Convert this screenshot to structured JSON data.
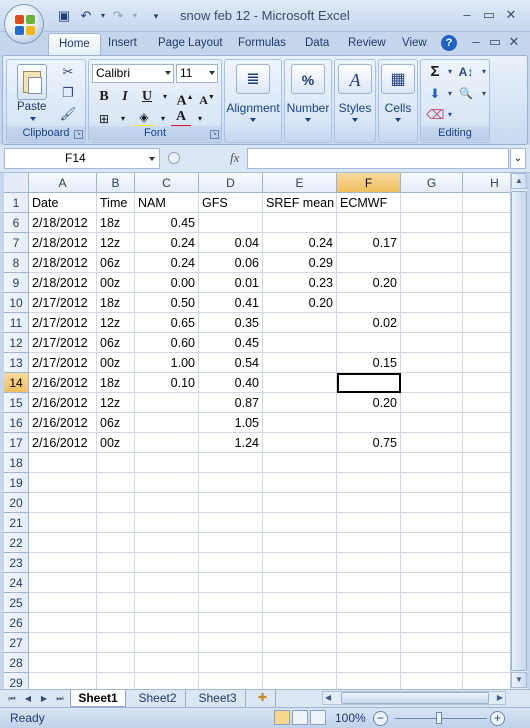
{
  "window": {
    "title": "snow feb 12 - Microsoft Excel",
    "controls": [
      "–",
      "▭",
      "✕"
    ],
    "workbook_controls": [
      "–",
      "▭",
      "✕"
    ]
  },
  "ribbon": {
    "tabs": [
      "Home",
      "Insert",
      "Page Layout",
      "Formulas",
      "Data",
      "Review",
      "View"
    ],
    "active_tab": "Home",
    "clipboard": {
      "label": "Clipboard",
      "paste": "Paste"
    },
    "font": {
      "label": "Font",
      "name": "Calibri",
      "size": "11"
    },
    "alignment": "Alignment",
    "number": "Number",
    "styles": "Styles",
    "cells": "Cells",
    "editing": "Editing"
  },
  "formula_bar": {
    "name_box": "F14",
    "fx": "fx",
    "formula": ""
  },
  "grid": {
    "columns": [
      "A",
      "B",
      "C",
      "D",
      "E",
      "F",
      "G",
      "H"
    ],
    "selected_column": "F",
    "rows": [
      {
        "n": "1",
        "cells": [
          "Date",
          "Time",
          "NAM",
          "GFS",
          "SREF mean",
          "ECMWF",
          "",
          ""
        ]
      },
      {
        "n": "6",
        "cells": [
          "2/18/2012",
          "18z",
          "0.45",
          "",
          "",
          "",
          "",
          ""
        ]
      },
      {
        "n": "7",
        "cells": [
          "2/18/2012",
          "12z",
          "0.24",
          "0.04",
          "0.24",
          "0.17",
          "",
          ""
        ]
      },
      {
        "n": "8",
        "cells": [
          "2/18/2012",
          "06z",
          "0.24",
          "0.06",
          "0.29",
          "",
          "",
          ""
        ]
      },
      {
        "n": "9",
        "cells": [
          "2/18/2012",
          "00z",
          "0.00",
          "0.01",
          "0.23",
          "0.20",
          "",
          ""
        ]
      },
      {
        "n": "10",
        "cells": [
          "2/17/2012",
          "18z",
          "0.50",
          "0.41",
          "0.20",
          "",
          "",
          ""
        ]
      },
      {
        "n": "11",
        "cells": [
          "2/17/2012",
          "12z",
          "0.65",
          "0.35",
          "",
          "0.02",
          "",
          ""
        ]
      },
      {
        "n": "12",
        "cells": [
          "2/17/2012",
          "06z",
          "0.60",
          "0.45",
          "",
          "",
          "",
          ""
        ]
      },
      {
        "n": "13",
        "cells": [
          "2/17/2012",
          "00z",
          "1.00",
          "0.54",
          "",
          "0.15",
          "",
          ""
        ]
      },
      {
        "n": "14",
        "cells": [
          "2/16/2012",
          "18z",
          "0.10",
          "0.40",
          "",
          "",
          "",
          ""
        ]
      },
      {
        "n": "15",
        "cells": [
          "2/16/2012",
          "12z",
          "",
          "0.87",
          "",
          "0.20",
          "",
          ""
        ]
      },
      {
        "n": "16",
        "cells": [
          "2/16/2012",
          "06z",
          "",
          "1.05",
          "",
          "",
          "",
          ""
        ]
      },
      {
        "n": "17",
        "cells": [
          "2/16/2012",
          "00z",
          "",
          "1.24",
          "",
          "0.75",
          "",
          ""
        ]
      },
      {
        "n": "18",
        "cells": [
          "",
          "",
          "",
          "",
          "",
          "",
          "",
          ""
        ]
      },
      {
        "n": "19",
        "cells": [
          "",
          "",
          "",
          "",
          "",
          "",
          "",
          ""
        ]
      },
      {
        "n": "20",
        "cells": [
          "",
          "",
          "",
          "",
          "",
          "",
          "",
          ""
        ]
      },
      {
        "n": "21",
        "cells": [
          "",
          "",
          "",
          "",
          "",
          "",
          "",
          ""
        ]
      },
      {
        "n": "22",
        "cells": [
          "",
          "",
          "",
          "",
          "",
          "",
          "",
          ""
        ]
      },
      {
        "n": "23",
        "cells": [
          "",
          "",
          "",
          "",
          "",
          "",
          "",
          ""
        ]
      },
      {
        "n": "24",
        "cells": [
          "",
          "",
          "",
          "",
          "",
          "",
          "",
          ""
        ]
      },
      {
        "n": "25",
        "cells": [
          "",
          "",
          "",
          "",
          "",
          "",
          "",
          ""
        ]
      },
      {
        "n": "26",
        "cells": [
          "",
          "",
          "",
          "",
          "",
          "",
          "",
          ""
        ]
      },
      {
        "n": "27",
        "cells": [
          "",
          "",
          "",
          "",
          "",
          "",
          "",
          ""
        ]
      },
      {
        "n": "28",
        "cells": [
          "",
          "",
          "",
          "",
          "",
          "",
          "",
          ""
        ]
      },
      {
        "n": "29",
        "cells": [
          "",
          "",
          "",
          "",
          "",
          "",
          "",
          ""
        ]
      }
    ],
    "active_cell": {
      "row": "14",
      "col": "F"
    }
  },
  "sheets": {
    "tabs": [
      "Sheet1",
      "Sheet2",
      "Sheet3"
    ],
    "active": "Sheet1"
  },
  "status": {
    "text": "Ready",
    "zoom": "100%"
  },
  "colors": {
    "accent": "#15428b",
    "selected_header": "#f1c15f",
    "ribbon_bg": "#c5d6ec"
  }
}
